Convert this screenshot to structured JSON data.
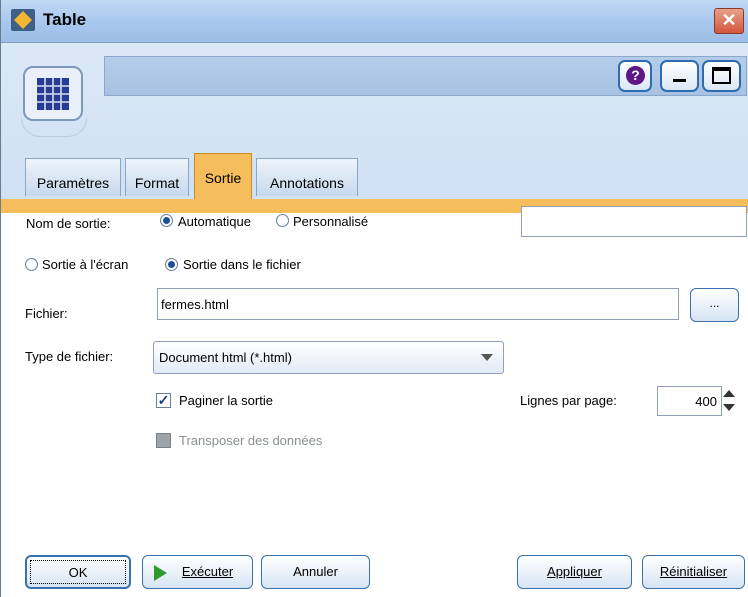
{
  "window": {
    "title": "Table",
    "close_glyph": "✕"
  },
  "header": {
    "help_glyph": "?",
    "node_icon": "table-node-icon"
  },
  "tabs": [
    {
      "label": "Paramètres",
      "active": false
    },
    {
      "label": "Format",
      "active": false
    },
    {
      "label": "Sortie",
      "active": true
    },
    {
      "label": "Annotations",
      "active": false
    }
  ],
  "output": {
    "name_label": "Nom de sortie:",
    "name_auto": "Automatique",
    "name_custom": "Personnalisé",
    "name_custom_value": "",
    "to_screen": "Sortie à l'écran",
    "to_file": "Sortie dans le fichier",
    "file_label": "Fichier:",
    "file_value": "fermes.html",
    "browse_label": "...",
    "file_type_label": "Type de fichier:",
    "file_type_value": "Document html (*.html)",
    "paginate_label": "Paginer la sortie",
    "lines_per_page_label": "Lignes par page:",
    "lines_per_page_value": "400",
    "transpose_label": "Transposer des données"
  },
  "footer": {
    "ok": "OK",
    "run": "Exécuter",
    "cancel": "Annuler",
    "apply": "Appliquer",
    "reset": "Réinitialiser"
  },
  "colors": {
    "active_tab": "#f6bd5d",
    "header_bg": "#d6e5f5",
    "accent_border": "#2f6bb2",
    "run_icon": "#2e9a2e"
  }
}
